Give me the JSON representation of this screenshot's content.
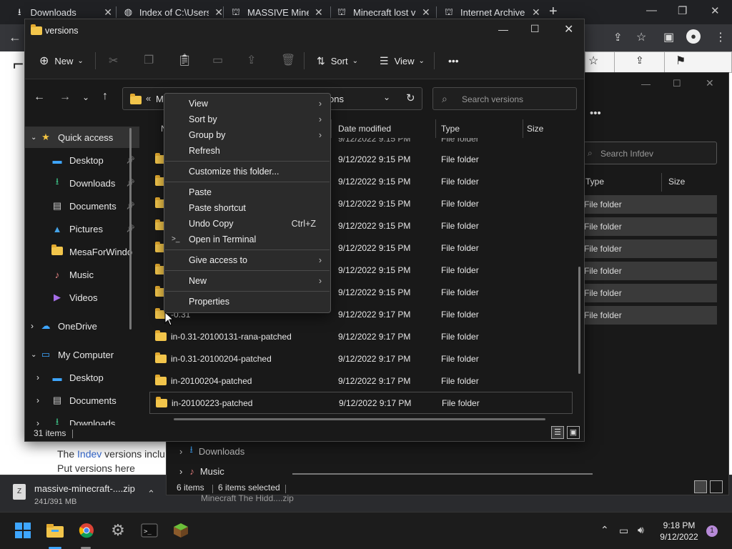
{
  "chrome": {
    "tabs": [
      {
        "label": "Downloads",
        "icon": "download-icon"
      },
      {
        "label": "Index of C:\\Users",
        "icon": "globe-icon"
      },
      {
        "label": "MASSIVE Minecraft",
        "icon": "wiki-icon"
      },
      {
        "label": "Minecraft lost ver",
        "icon": "wiki-icon"
      },
      {
        "label": "Internet Archive",
        "icon": "archive-icon"
      }
    ],
    "new_tab": "+"
  },
  "page": {
    "line1_pre": "The ",
    "line1_link": "Indev",
    "line1_post": " versions inclu",
    "line2": "Put versions here"
  },
  "download": {
    "filename": "massive-minecraft-....zip",
    "progress": "241/391 MB",
    "other_file": "Minecraft The Hidd....zip"
  },
  "explorer": {
    "title": "versions",
    "toolbar": {
      "new": "New",
      "sort": "Sort",
      "view": "View",
      "more": "•••"
    },
    "address": {
      "prefix": "«",
      "partial": "M",
      "current": "ons",
      "search_placeholder": "Search versions"
    },
    "columns": {
      "name": "N",
      "date": "Date modified",
      "type": "Type",
      "size": "Size"
    },
    "nav": [
      {
        "label": "Quick access",
        "icon": "star-icon"
      },
      {
        "label": "Desktop",
        "icon": "desktop-icon"
      },
      {
        "label": "Downloads",
        "icon": "download-icon"
      },
      {
        "label": "Documents",
        "icon": "document-icon"
      },
      {
        "label": "Pictures",
        "icon": "picture-icon"
      },
      {
        "label": "MesaForWindo",
        "icon": "folder-icon"
      },
      {
        "label": "Music",
        "icon": "music-icon"
      },
      {
        "label": "Videos",
        "icon": "video-icon"
      },
      {
        "label": "OneDrive",
        "icon": "cloud-icon"
      },
      {
        "label": "My Computer",
        "icon": "computer-icon"
      },
      {
        "label": "Desktop",
        "icon": "desktop-icon"
      },
      {
        "label": "Documents",
        "icon": "document-icon"
      },
      {
        "label": "Downloads",
        "icon": "download-icon"
      }
    ],
    "files": [
      {
        "name": "",
        "date": "9/12/2022 9:15 PM",
        "type": "File folder"
      },
      {
        "name": "",
        "date": "9/12/2022 9:15 PM",
        "type": "File folder"
      },
      {
        "name": "",
        "date": "9/12/2022 9:15 PM",
        "type": "File folder"
      },
      {
        "name": "",
        "date": "9/12/2022 9:15 PM",
        "type": "File folder"
      },
      {
        "name": "",
        "date": "9/12/2022 9:15 PM",
        "type": "File folder"
      },
      {
        "name": "",
        "date": "9/12/2022 9:15 PM",
        "type": "File folder"
      },
      {
        "name": "",
        "date": "9/12/2022 9:15 PM",
        "type": "File folder"
      },
      {
        "name": "",
        "date": "9/12/2022 9:15 PM",
        "type": "File folder"
      },
      {
        "name": "-0.31",
        "date": "9/12/2022 9:17 PM",
        "type": "File folder"
      },
      {
        "name": "in-0.31-20100131-rana-patched",
        "date": "9/12/2022 9:17 PM",
        "type": "File folder"
      },
      {
        "name": "in-0.31-20100204-patched",
        "date": "9/12/2022 9:17 PM",
        "type": "File folder"
      },
      {
        "name": "in-20100204-patched",
        "date": "9/12/2022 9:17 PM",
        "type": "File folder"
      },
      {
        "name": "in-20100223-patched",
        "date": "9/12/2022 9:17 PM",
        "type": "File folder"
      }
    ],
    "status": "31 items"
  },
  "explorer_back": {
    "search_placeholder": "Search Infdev",
    "columns": {
      "type": "Type",
      "size": "Size"
    },
    "rows": [
      "File folder",
      "File folder",
      "File folder",
      "File folder",
      "File folder",
      "File folder"
    ],
    "nav": [
      {
        "label": "Downloads"
      },
      {
        "label": "Music"
      }
    ],
    "status_count": "6 items",
    "status_selected": "6 items selected"
  },
  "context_menu": {
    "items": [
      {
        "label": "View",
        "submenu": true
      },
      {
        "label": "Sort by",
        "submenu": true
      },
      {
        "label": "Group by",
        "submenu": true
      },
      {
        "label": "Refresh"
      },
      {
        "label": "Customize this folder..."
      },
      {
        "label": "Paste"
      },
      {
        "label": "Paste shortcut"
      },
      {
        "label": "Undo Copy",
        "shortcut": "Ctrl+Z"
      },
      {
        "label": "Open in Terminal"
      },
      {
        "label": "Give access to",
        "submenu": true
      },
      {
        "label": "New",
        "submenu": true
      },
      {
        "label": "Properties"
      }
    ],
    "arrow": "›"
  },
  "taskbar": {
    "time": "9:18 PM",
    "date": "9/12/2022",
    "notification_count": "1"
  }
}
